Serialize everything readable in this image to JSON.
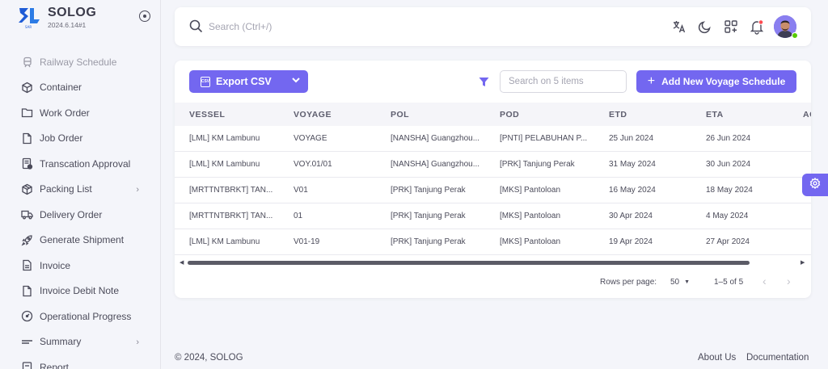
{
  "brand": {
    "name": "SOLOG",
    "version": "2024.6.14#1"
  },
  "sidebar": {
    "items": [
      {
        "label": "Railway Schedule",
        "icon": "train-icon",
        "faded": true
      },
      {
        "label": "Container",
        "icon": "box-icon"
      },
      {
        "label": "Work Order",
        "icon": "folder-icon"
      },
      {
        "label": "Job Order",
        "icon": "file-icon"
      },
      {
        "label": "Transcation Approval",
        "icon": "clipboard-check-icon"
      },
      {
        "label": "Packing List",
        "icon": "package-icon",
        "chevron": true
      },
      {
        "label": "Delivery Order",
        "icon": "truck-icon"
      },
      {
        "label": "Generate Shipment",
        "icon": "rocket-icon"
      },
      {
        "label": "Invoice",
        "icon": "invoice-icon"
      },
      {
        "label": "Invoice Debit Note",
        "icon": "file-icon"
      },
      {
        "label": "Operational Progress",
        "icon": "gauge-icon"
      },
      {
        "label": "Summary",
        "icon": "lines-icon",
        "chevron": true
      },
      {
        "label": "Report",
        "icon": "report-icon"
      }
    ]
  },
  "topbar": {
    "search_placeholder": "Search (Ctrl+/)",
    "icons": [
      "translate-icon",
      "moon-icon",
      "grid-add-icon",
      "bell-icon"
    ]
  },
  "toolbar": {
    "export_label": "Export CSV",
    "csv_icon_text": "CSV",
    "search_placeholder": "Search on 5 items",
    "add_label": "Add New Voyage Schedule"
  },
  "table": {
    "columns": [
      "VESSEL",
      "VOYAGE",
      "POL",
      "POD",
      "ETD",
      "ETA",
      "AC"
    ],
    "rows": [
      [
        "[LML] KM Lambunu",
        "VOYAGE",
        "[NANSHA] Guangzhou...",
        "[PNTI] PELABUHAN P...",
        "25 Jun 2024",
        "26 Jun 2024"
      ],
      [
        "[LML] KM Lambunu",
        "VOY.01/01",
        "[NANSHA] Guangzhou...",
        "[PRK] Tanjung Perak",
        "31 May 2024",
        "30 Jun 2024"
      ],
      [
        "[MRTTNTBRKT] TAN...",
        "V01",
        "[PRK] Tanjung Perak",
        "[MKS] Pantoloan",
        "16 May 2024",
        "18 May 2024"
      ],
      [
        "[MRTTNTBRKT] TAN...",
        "01",
        "[PRK] Tanjung Perak",
        "[MKS] Pantoloan",
        "30 Apr 2024",
        "4 May 2024"
      ],
      [
        "[LML] KM Lambunu",
        "V01-19",
        "[PRK] Tanjung Perak",
        "[MKS] Pantoloan",
        "19 Apr 2024",
        "27 Apr 2024"
      ]
    ]
  },
  "pagination": {
    "rows_per_page_label": "Rows per page:",
    "rows_per_page": "50",
    "range": "1–5 of 5"
  },
  "footer": {
    "copyright": "© 2024, SOLOG",
    "about": "About Us",
    "documentation": "Documentation"
  },
  "colors": {
    "accent": "#7367f0",
    "notification": "#ff4c51",
    "online": "#56ca00"
  }
}
